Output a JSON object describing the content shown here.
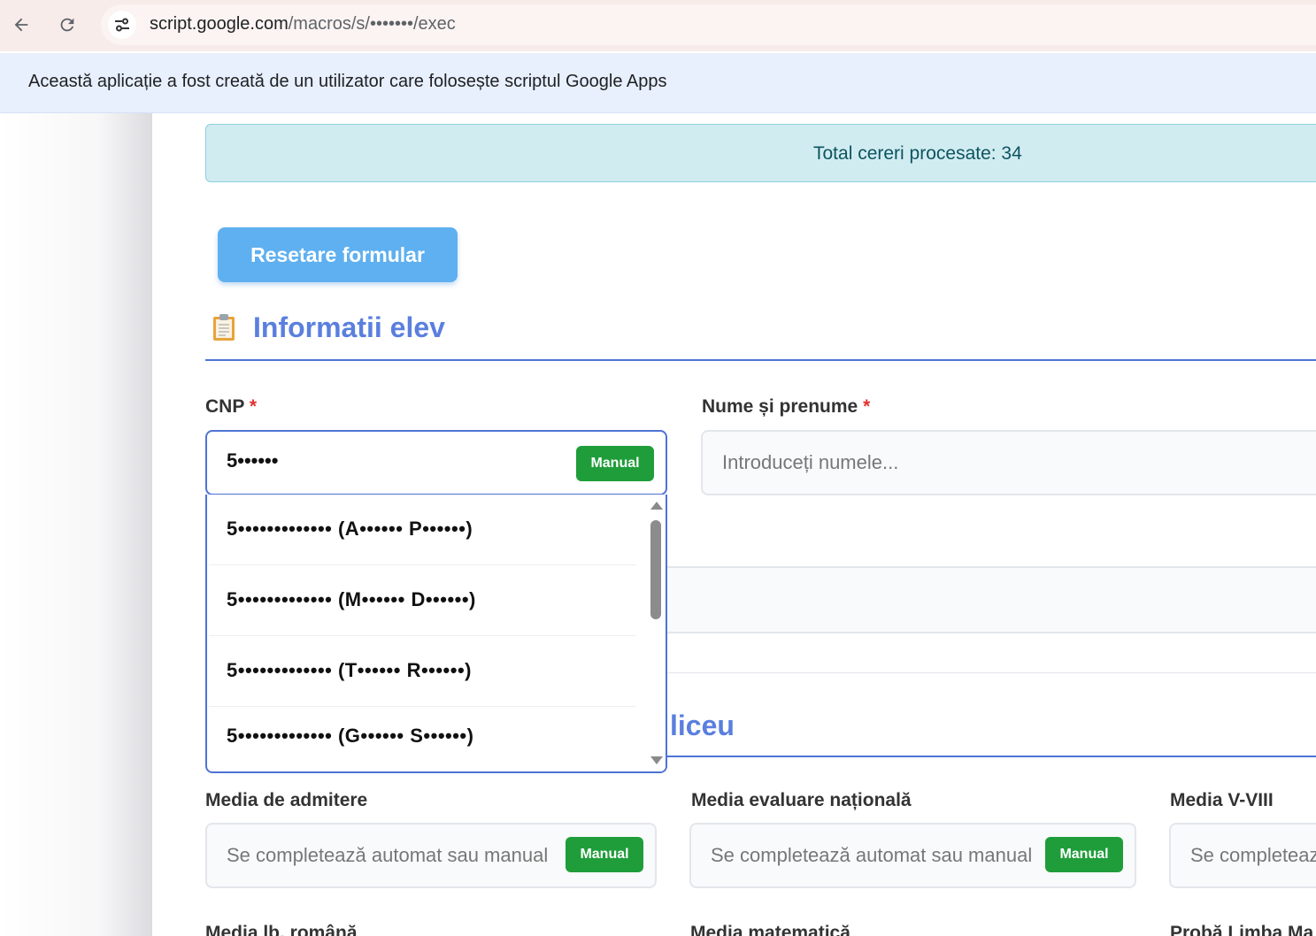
{
  "browser": {
    "url_host": "script.google.com",
    "url_path": "/macros/s/•••••••/exec",
    "back_icon": "arrow-left-icon",
    "reload_icon": "reload-icon",
    "site_info_icon": "tune-icon"
  },
  "banner": {
    "text": "Această aplicație a fost creată de un utilizator care folosește scriptul Google Apps"
  },
  "alert": {
    "text": "Total cereri procesate: 34"
  },
  "reset_button": {
    "label": "Resetare formular"
  },
  "sections": {
    "student_info": {
      "title": "Informatii elev",
      "icon": "clipboard-icon"
    },
    "high_school": {
      "title_visible_part": "liceu"
    }
  },
  "fields": {
    "cnp": {
      "label": "CNP",
      "required_mark": "*",
      "value": "5••••••",
      "badge": "Manual"
    },
    "name": {
      "label": "Nume și prenume",
      "required_mark": "*",
      "placeholder": "Introduceți numele..."
    },
    "media_admitere": {
      "label": "Media de admitere",
      "placeholder": "Se completează automat sau manual",
      "badge": "Manual"
    },
    "media_en": {
      "label": "Media evaluare națională",
      "placeholder": "Se completează automat sau manual",
      "badge": "Manual"
    },
    "media_v_viii": {
      "label": "Media V-VIII",
      "placeholder": "Se completeaz"
    },
    "media_romana": {
      "label": "Media lb. română"
    },
    "media_matematica": {
      "label": "Media matematică"
    },
    "proba_limba": {
      "label": "Probă Limba Ma"
    }
  },
  "dropdown": {
    "items": [
      "5••••••••••••• (A•••••• P••••••)",
      "5••••••••••••• (M•••••• D••••••)",
      "5••••••••••••• (T•••••• R••••••)",
      "5••••••••••••• (G•••••• S••••••)"
    ]
  },
  "colors": {
    "accent": "#4e73d4",
    "section_title": "#5a7fde",
    "manual_badge": "#1f9d3a",
    "reset_button": "#5fb0f0",
    "alert_bg": "#d1ecf1",
    "alert_text": "#0c5460",
    "banner_bg": "#e8f0fe"
  }
}
